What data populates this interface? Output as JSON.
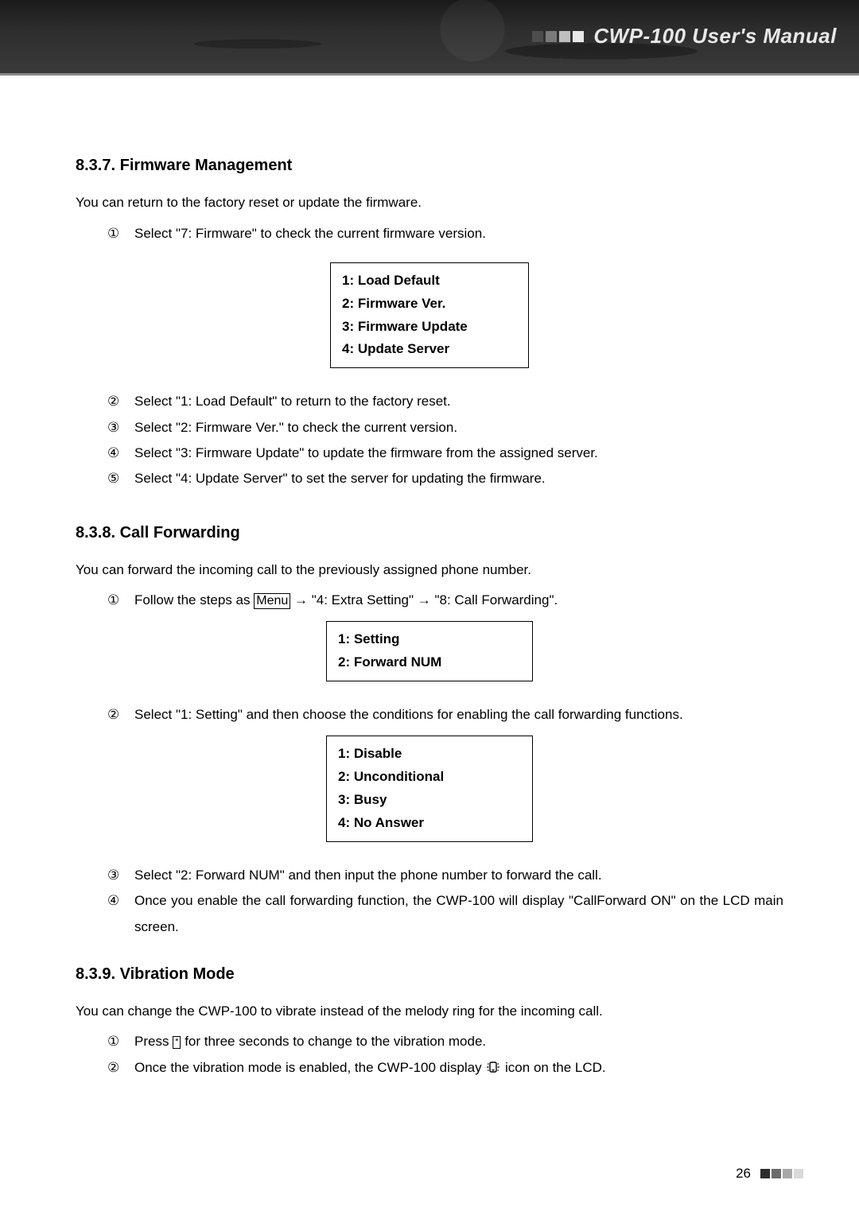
{
  "header": {
    "title": "CWP-100 User's Manual"
  },
  "section_firmware": {
    "heading": "8.3.7. Firmware Management",
    "intro": "You can return to the factory reset or update the firmware.",
    "step1": "Select \"7: Firmware\" to check the current firmware version.",
    "menu": {
      "row1": "1: Load Default",
      "row2": "2: Firmware Ver.",
      "row3": "3: Firmware Update",
      "row4": "4: Update Server"
    },
    "step2": "Select \"1: Load Default\" to return to the factory reset.",
    "step3": "Select \"2: Firmware Ver.\" to check the current version.",
    "step4": "Select \"3: Firmware Update\" to update the firmware from the assigned server.",
    "step5": "Select \"4: Update Server\" to set the server for updating the firmware."
  },
  "section_callfwd": {
    "heading": "8.3.8. Call Forwarding",
    "intro": "You can forward the incoming call to the previously assigned phone number.",
    "step1_pre": "Follow the steps as ",
    "step1_menu_key": "Menu",
    "step1_mid1": " → \"4: Extra Setting\" → \"8: Call Forwarding\".",
    "menu1": {
      "row1": "1: Setting",
      "row2": "2: Forward NUM"
    },
    "step2": "Select \"1: Setting\" and then choose the conditions for enabling the call forwarding functions.",
    "menu2": {
      "row1": "1: Disable",
      "row2": "2: Unconditional",
      "row3": "3: Busy",
      "row4": "4: No Answer"
    },
    "step3": "Select \"2: Forward NUM\" and then input the phone number to forward the call.",
    "step4": "Once you enable the call forwarding function, the CWP-100 will display \"CallForward ON\" on the LCD main screen."
  },
  "section_vibration": {
    "heading": "8.3.9. Vibration Mode",
    "intro": "You can change the CWP-100 to vibrate instead of the melody ring for the incoming call.",
    "step1_pre": "Press ",
    "step1_key": "*",
    "step1_post": " for three seconds to change to the vibration mode.",
    "step2_pre": "Once the vibration mode is enabled, the CWP-100 display ",
    "step2_post": " icon on the LCD."
  },
  "footer": {
    "page_number": "26"
  },
  "enum": {
    "n1": "①",
    "n2": "②",
    "n3": "③",
    "n4": "④",
    "n5": "⑤"
  }
}
